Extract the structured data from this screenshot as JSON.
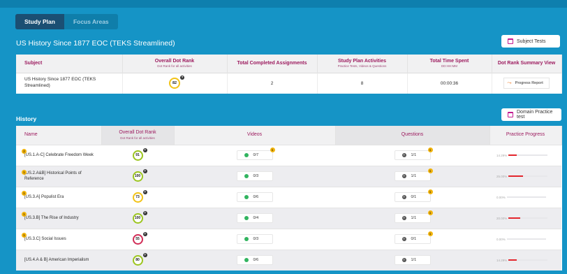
{
  "tabs": [
    {
      "label": "Study Plan",
      "active": true
    },
    {
      "label": "Focus Areas",
      "active": false
    }
  ],
  "course_title": "US History Since 1877 EOC (TEKS Streamlined)",
  "buttons": {
    "subject_tests": "Subject Tests",
    "domain_practice": "Domain Practice test",
    "progress_report": "Progress Report"
  },
  "summary": {
    "headers": {
      "subject": "Subject",
      "rank": "Overall Dot Rank",
      "rank_sub": "Dot Rank for all activities",
      "completed": "Total Completed Assignments",
      "activities": "Study Plan Activities",
      "activities_sub": "Practice Tests, Videos & Questions",
      "time": "Total Time Spent",
      "time_sub": "DD:HH:MM",
      "view": "Dot Rank Summary View"
    },
    "row": {
      "subject": "US History Since 1877 EOC (TEKS Streamlined)",
      "rank": "82",
      "completed": "2",
      "activities": "8",
      "time": "00:00:36"
    }
  },
  "history": {
    "title": "History",
    "headers": {
      "name": "Name",
      "rank": "Overall Dot Rank",
      "rank_sub": "Dot Rank for all activities",
      "videos": "Videos",
      "questions": "Questions",
      "practice": "Practice Progress"
    },
    "rows": [
      {
        "badge": "2",
        "name": "[US.1.A-C] Celebrate Freedom Week",
        "rank": "91",
        "rank_color": "#9cc51f",
        "videos": "0/7",
        "video_badge": "1",
        "questions": "1/1",
        "question_badge": "1",
        "practice": "14.29%",
        "practice_pct": 14.29
      },
      {
        "badge": "1",
        "name": "[US.2.A&B] Historical Points of Reference",
        "rank": "100",
        "rank_color": "#9cc51f",
        "videos": "0/3",
        "video_badge": "",
        "questions": "1/1",
        "question_badge": "1",
        "practice": "25.00%",
        "practice_pct": 25.0
      },
      {
        "badge": "1",
        "name": "[US.3.A] Populist Era",
        "rank": "73",
        "rank_color": "#f2c318",
        "videos": "0/6",
        "video_badge": "",
        "questions": "0/1",
        "question_badge": "1",
        "practice": "0.00%",
        "practice_pct": 0
      },
      {
        "badge": "1",
        "name": "[US.3.B] The Rise of Industry",
        "rank": "100",
        "rank_color": "#9cc51f",
        "videos": "0/4",
        "video_badge": "",
        "questions": "1/1",
        "question_badge": "1",
        "practice": "20.00%",
        "practice_pct": 20.0
      },
      {
        "badge": "1",
        "name": "[US.3.C] Social Issues",
        "rank": "55",
        "rank_color": "#d12d57",
        "videos": "0/3",
        "video_badge": "",
        "questions": "0/1",
        "question_badge": "1",
        "practice": "0.00%",
        "practice_pct": 0
      },
      {
        "badge": "",
        "name": "[US.4.A & B] American Imperialism",
        "rank": "80",
        "rank_color": "#9cc51f",
        "videos": "0/6",
        "video_badge": "",
        "questions": "1/1",
        "question_badge": "",
        "practice": "14.29%",
        "practice_pct": 14.29
      }
    ]
  },
  "colors": {
    "background": "#1594c6",
    "tab_active": "#1b4f73",
    "header_text": "#9c1a5e",
    "badge": "#f1b40d",
    "progress_fill": "#e3262d",
    "video_icon": "#31b45f"
  },
  "icons": {
    "subject_tests": "calendar-icon",
    "domain_practice": "calendar-icon",
    "progress_report": "trend-chart-icon",
    "videos": "play-icon",
    "questions": "question-icon"
  }
}
